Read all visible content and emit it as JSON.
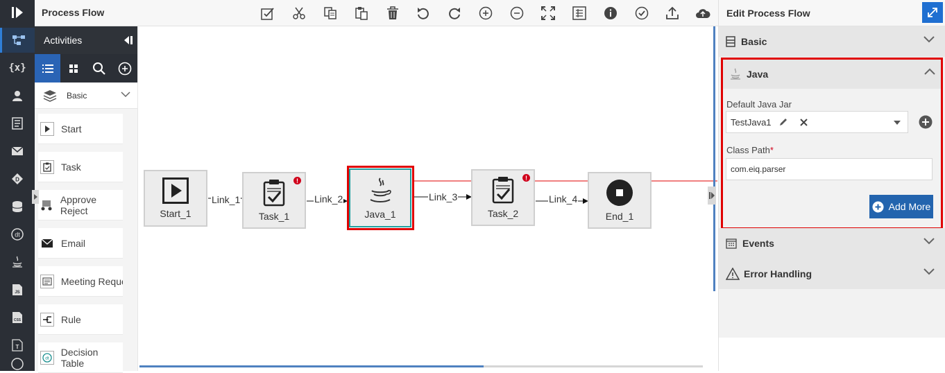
{
  "toolbar": {
    "title": "Process Flow",
    "buttons": [
      "validate",
      "cut",
      "copy",
      "paste",
      "delete",
      "undo",
      "redo",
      "zoom-in",
      "zoom-out",
      "fit-screen",
      "properties-grid",
      "info",
      "check",
      "export",
      "cloud-upload"
    ]
  },
  "palette": {
    "header": "Activities",
    "category": "Basic",
    "items": [
      {
        "label": "Start"
      },
      {
        "label": "Task"
      },
      {
        "label": "Approve Reject"
      },
      {
        "label": "Email"
      },
      {
        "label": "Meeting Reques"
      },
      {
        "label": "Rule"
      },
      {
        "label": "Decision Table"
      }
    ]
  },
  "canvas": {
    "nodes": [
      {
        "label": "Start_1"
      },
      {
        "label": "Task_1"
      },
      {
        "label": "Java_1"
      },
      {
        "label": "Task_2"
      },
      {
        "label": "End_1"
      }
    ],
    "links": [
      "Link_1",
      "Link_2",
      "Link_3",
      "Link_4"
    ],
    "error_badge": "!"
  },
  "editor": {
    "title": "Edit Process Flow",
    "sections": {
      "basic": "Basic",
      "java": "Java",
      "events": "Events",
      "error_handling": "Error Handling"
    },
    "java": {
      "jar_label": "Default Java Jar",
      "jar_value": "TestJava1",
      "classpath_label": "Class Path",
      "classpath_required": "*",
      "classpath_value": "com.eiq.parser",
      "add_more": "Add More"
    }
  },
  "colors": {
    "accent": "#2364ae",
    "highlight": "#e00000",
    "rail": "#2b2f36",
    "error": "#d0021b"
  }
}
